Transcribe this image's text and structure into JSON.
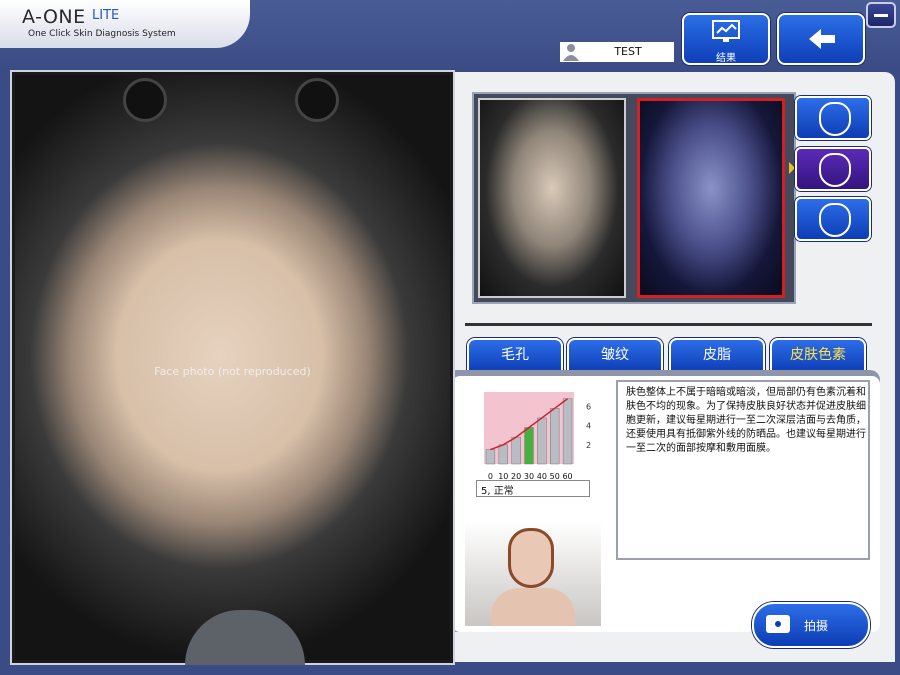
{
  "app": {
    "logo_main": "A-ONE",
    "logo_lite": "LITE",
    "logo_sub": "One Click Skin Diagnosis System"
  },
  "header": {
    "user_name": "TEST",
    "result_label": "结果"
  },
  "tabs": [
    {
      "label": "毛孔"
    },
    {
      "label": "皱纹"
    },
    {
      "label": "皮脂"
    },
    {
      "label": "皮肤色素",
      "selected": true
    }
  ],
  "analysis": {
    "advice": "肤色整体上不属于暗暗或暗淡，但局部仍有色素沉着和肤色不均的现象。为了保持皮肤良好状态并促进皮肤细胞更新，建议每星期进行一至二次深层洁面与去角质，还要使用具有抵御紫外线的防晒品。也建议每星期进行一至二次的面部按摩和敷用面膜。",
    "score_text": "5, 正常"
  },
  "chart_data": {
    "type": "bar",
    "categories": [
      "0",
      "10",
      "20",
      "30",
      "40",
      "50",
      "60"
    ],
    "values": [
      1.5,
      2,
      2.8,
      3.8,
      4.8,
      5.8,
      6.8
    ],
    "highlight_index": 3,
    "y_ticks": [
      2,
      4,
      6
    ],
    "ylim": [
      0,
      7.5
    ],
    "colors": {
      "bar": "#b9bcc3",
      "highlight": "#46b040",
      "curve": "#d02030",
      "bg": "#f3c4cf"
    }
  },
  "placeholders": {
    "main_photo": "Face photo (not reproduced)"
  },
  "capture": {
    "label": "拍摄"
  },
  "colors": {
    "accent": "#0d3db5",
    "selected_tab_text": "#ffe14a",
    "uv_frame": "#d42020"
  }
}
